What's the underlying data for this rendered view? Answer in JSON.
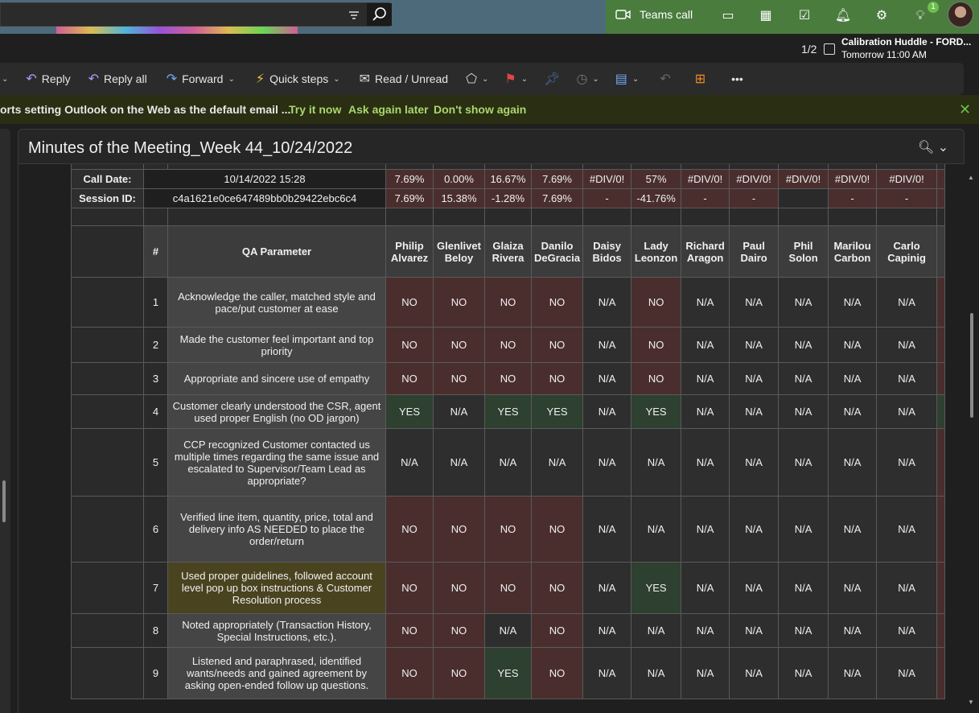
{
  "search": {
    "placeholder": ""
  },
  "topbar": {
    "teams_label": "Teams call",
    "badge_count": "1"
  },
  "meeting": {
    "pager": "1/2",
    "title": "Calibration Huddle - FORD...",
    "time": "Tomorrow 11:00 AM"
  },
  "ribbon": {
    "reply": "Reply",
    "reply_all": "Reply all",
    "forward": "Forward",
    "quick_steps": "Quick steps",
    "read_unread": "Read / Unread",
    "more": "•••"
  },
  "infobar": {
    "message": "orts setting Outlook on the Web as the default email ...",
    "try": "Try it now",
    "later": "Ask again later",
    "never": "Don't show again"
  },
  "email": {
    "subject": "Minutes of the Meeting_Week 44_10/24/2022"
  },
  "table": {
    "meta": [
      {
        "label": "Call Date:",
        "value": "10/14/2022 15:28",
        "pcts": [
          "7.69%",
          "0.00%",
          "16.67%",
          "7.69%",
          "#DIV/0!",
          "57%",
          "#DIV/0!",
          "#DIV/0!",
          "#DIV/0!",
          "#DIV/0!",
          "#DIV/0!"
        ]
      },
      {
        "label": "Session ID:",
        "value": "c4a1621e0ce647489bb0b29422ebc6c4",
        "pcts": [
          "7.69%",
          "15.38%",
          "-1.28%",
          "7.69%",
          "-",
          "-41.76%",
          "-",
          "-",
          "",
          "-",
          "-"
        ]
      }
    ],
    "hash": "#",
    "param_header": "QA Parameter",
    "people": [
      "Philip Alvarez",
      "Glenlivet Beloy",
      "Glaiza Rivera",
      "Danilo DeGracia",
      "Daisy Bidos",
      "Lady Leonzon",
      "Richard Aragon",
      "Paul Dairo",
      "Phil Solon",
      "Marilou Carbon",
      "Carlo Capinig"
    ],
    "rows": [
      {
        "n": "1",
        "p": "Acknowledge the caller, matched style and pace/put customer at ease",
        "v": [
          "NO",
          "NO",
          "NO",
          "NO",
          "N/A",
          "NO",
          "N/A",
          "N/A",
          "N/A",
          "N/A",
          "N/A"
        ]
      },
      {
        "n": "2",
        "p": "Made the customer feel important and top priority",
        "v": [
          "NO",
          "NO",
          "NO",
          "NO",
          "N/A",
          "NO",
          "N/A",
          "N/A",
          "N/A",
          "N/A",
          "N/A"
        ]
      },
      {
        "n": "3",
        "p": "Appropriate and sincere use of empathy",
        "v": [
          "NO",
          "NO",
          "NO",
          "NO",
          "N/A",
          "NO",
          "N/A",
          "N/A",
          "N/A",
          "N/A",
          "N/A"
        ]
      },
      {
        "n": "4",
        "p": "Customer clearly understood the CSR, agent used  proper English (no OD jargon)",
        "v": [
          "YES",
          "N/A",
          "YES",
          "YES",
          "N/A",
          "YES",
          "N/A",
          "N/A",
          "N/A",
          "N/A",
          "N/A"
        ]
      },
      {
        "n": "5",
        "p": "CCP recognized Customer contacted us multiple times regarding the same issue and escalated to Supervisor/Team Lead as appropriate?",
        "v": [
          "N/A",
          "N/A",
          "N/A",
          "N/A",
          "N/A",
          "N/A",
          "N/A",
          "N/A",
          "N/A",
          "N/A",
          "N/A"
        ]
      },
      {
        "n": "6",
        "p": "Verified line item, quantity, price, total and delivery info AS NEEDED to place the order/return",
        "v": [
          "NO",
          "NO",
          "NO",
          "NO",
          "N/A",
          "N/A",
          "N/A",
          "N/A",
          "N/A",
          "N/A",
          "N/A"
        ]
      },
      {
        "n": "7",
        "p": "Used proper guidelines, followed account level pop up box instructions & Customer Resolution process",
        "v": [
          "NO",
          "NO",
          "NO",
          "NO",
          "N/A",
          "YES",
          "N/A",
          "N/A",
          "N/A",
          "N/A",
          "N/A"
        ],
        "hl": true
      },
      {
        "n": "8",
        "p": "Noted appropriately (Transaction History, Special Instructions, etc.).",
        "v": [
          "NO",
          "NO",
          "N/A",
          "NO",
          "N/A",
          "N/A",
          "N/A",
          "N/A",
          "N/A",
          "N/A",
          "N/A"
        ]
      },
      {
        "n": "9",
        "p": "Listened and paraphrased, identified wants/needs and gained agreement by asking open-ended follow up questions.",
        "v": [
          "NO",
          "NO",
          "YES",
          "NO",
          "N/A",
          "N/A",
          "N/A",
          "N/A",
          "N/A",
          "N/A",
          "N/A"
        ]
      }
    ]
  }
}
